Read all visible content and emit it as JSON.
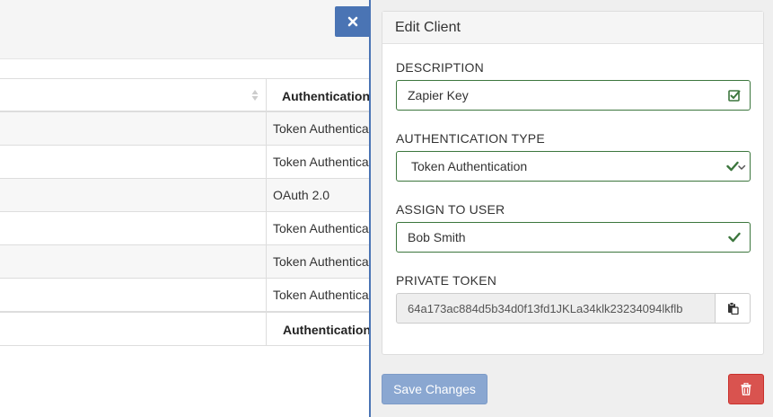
{
  "background": {
    "table": {
      "column_header": "Authentication",
      "rows": [
        {
          "auth_type": "Token Authentica"
        },
        {
          "auth_type": "Token Authentica"
        },
        {
          "auth_type": "OAuth 2.0"
        },
        {
          "auth_type": "Token Authentica"
        },
        {
          "auth_type": "Token Authentica"
        },
        {
          "auth_type": "Token Authentica"
        }
      ],
      "footer_header": "Authentication"
    }
  },
  "panel": {
    "title": "Edit Client",
    "fields": {
      "description": {
        "label": "DESCRIPTION",
        "value": "Zapier Key"
      },
      "auth_type": {
        "label": "AUTHENTICATION TYPE",
        "value": "Token Authentication"
      },
      "assign_user": {
        "label": "ASSIGN TO USER",
        "value": "Bob Smith"
      },
      "private_token": {
        "label": "PRIVATE TOKEN",
        "value": "64a173ac884d5b34d0f13fd1JKLa34klk23234094lkflb"
      }
    },
    "save_label": "Save Changes"
  },
  "colors": {
    "primary": "#4a74b4",
    "success": "#3c763d",
    "danger": "#d9534f",
    "save_disabled": "#8aa7d1"
  },
  "icons": {
    "close": "close-icon",
    "sort": "sort-icon",
    "edit_check": "edit-check-icon",
    "check": "check-icon",
    "clipboard": "clipboard-icon",
    "trash": "trash-icon"
  }
}
